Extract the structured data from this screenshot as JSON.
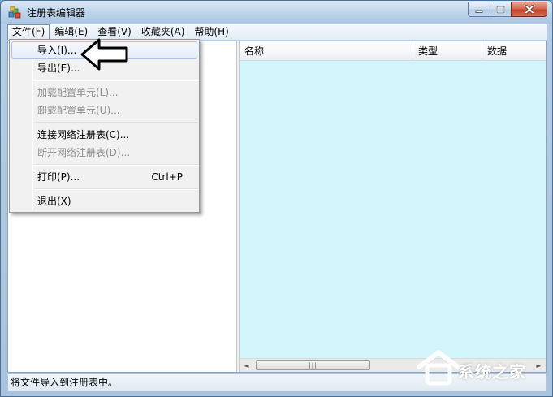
{
  "window": {
    "title": "注册表编辑器",
    "icon": "registry-editor-icon"
  },
  "menubar": {
    "items": [
      {
        "label": "文件(F)",
        "open": true
      },
      {
        "label": "编辑(E)"
      },
      {
        "label": "查看(V)"
      },
      {
        "label": "收藏夹(A)"
      },
      {
        "label": "帮助(H)"
      }
    ]
  },
  "file_menu": {
    "items": [
      {
        "label": "导入(I)...",
        "enabled": true,
        "highlighted": true
      },
      {
        "label": "导出(E)...",
        "enabled": true
      },
      {
        "label": "加载配置单元(L)...",
        "enabled": false
      },
      {
        "label": "卸载配置单元(U)...",
        "enabled": false
      },
      {
        "label": "连接网络注册表(C)...",
        "enabled": true
      },
      {
        "label": "断开网络注册表(D)...",
        "enabled": false
      },
      {
        "label": "打印(P)...",
        "shortcut": "Ctrl+P",
        "enabled": true
      },
      {
        "label": "退出(X)",
        "enabled": true
      }
    ]
  },
  "list_view": {
    "columns": [
      "名称",
      "类型",
      "数据"
    ],
    "background": "#d2f4fb"
  },
  "scrollbar": {
    "left_arrow": "◄",
    "right_arrow": "►",
    "thumb_grip": "|||"
  },
  "statusbar": {
    "text": "将文件导入到注册表中。"
  },
  "watermark": {
    "text": "系统之家"
  }
}
